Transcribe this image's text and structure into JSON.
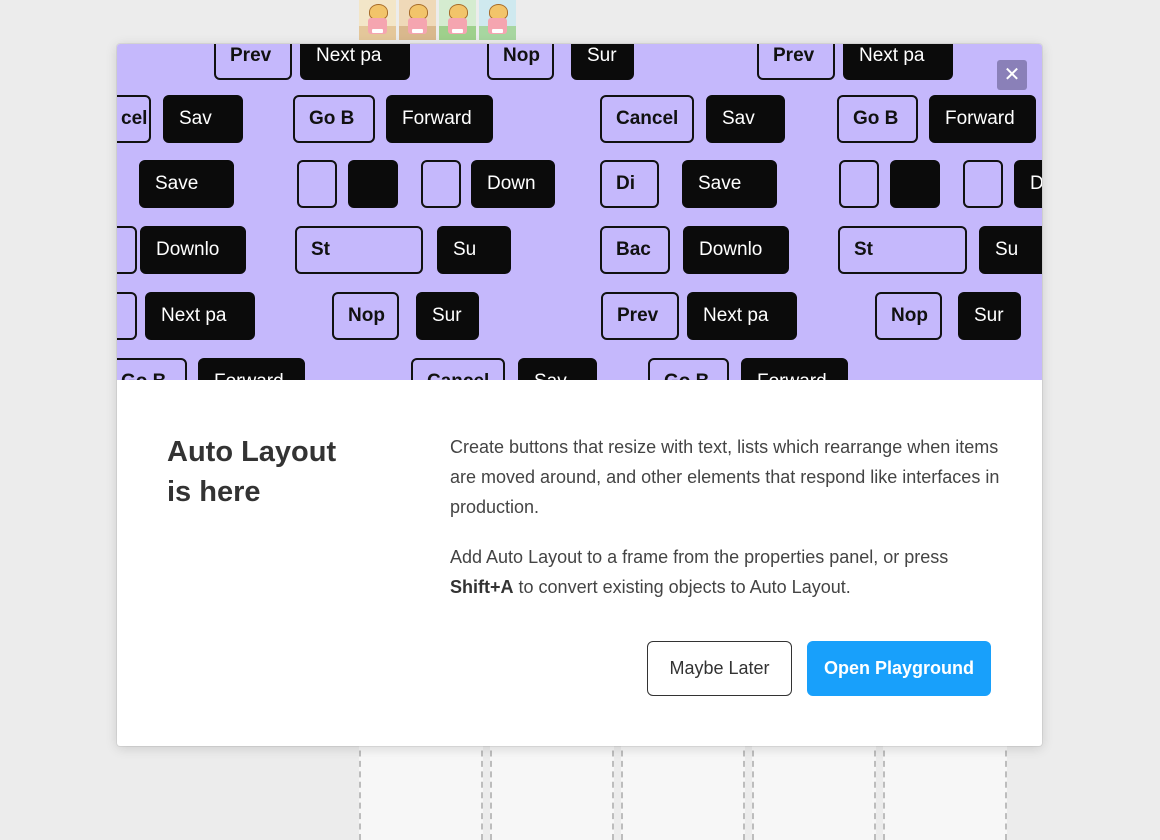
{
  "modal": {
    "title_line1": "Auto Layout",
    "title_line2": "is here",
    "paragraph1": "Create buttons that resize with text, lists which rearrange when items are moved around, and other elements that respond like interfaces in production.",
    "paragraph2_prefix": "Add Auto Layout to a frame from the properties panel, or press",
    "paragraph2_shortcut": "Shift+A",
    "paragraph2_suffix": "to convert existing objects to Auto Layout.",
    "close_label": "✕",
    "maybe_later_label": "Maybe Later",
    "open_playground_label": "Open Playground",
    "accent_color": "#18a0fb",
    "hero_color": "#c5b8fc"
  },
  "hero_buttons": [
    {
      "label": "Prev",
      "style": "light"
    },
    {
      "label": "Next pa",
      "style": "dark"
    },
    {
      "label": "Nop",
      "style": "light"
    },
    {
      "label": "Sur",
      "style": "dark"
    },
    {
      "label": "Prev",
      "style": "light"
    },
    {
      "label": "Next pa",
      "style": "dark"
    },
    {
      "label": "cel",
      "style": "light"
    },
    {
      "label": "Sav",
      "style": "dark"
    },
    {
      "label": "Go B",
      "style": "light"
    },
    {
      "label": "Forward",
      "style": "dark"
    },
    {
      "label": "Cancel",
      "style": "light"
    },
    {
      "label": "Sav",
      "style": "dark"
    },
    {
      "label": "Go B",
      "style": "light"
    },
    {
      "label": "Forward",
      "style": "dark"
    },
    {
      "label": "Save",
      "style": "dark"
    },
    {
      "label": "",
      "style": "light"
    },
    {
      "label": "",
      "style": "dark"
    },
    {
      "label": "",
      "style": "light"
    },
    {
      "label": "Down",
      "style": "dark"
    },
    {
      "label": "Di",
      "style": "light"
    },
    {
      "label": "Save",
      "style": "dark"
    },
    {
      "label": "",
      "style": "light"
    },
    {
      "label": "",
      "style": "dark"
    },
    {
      "label": "",
      "style": "light"
    },
    {
      "label": "D",
      "style": "dark"
    },
    {
      "label": "",
      "style": "light"
    },
    {
      "label": "Downlo",
      "style": "dark"
    },
    {
      "label": "St",
      "style": "light"
    },
    {
      "label": "Su",
      "style": "dark"
    },
    {
      "label": "Bac",
      "style": "light"
    },
    {
      "label": "Downlo",
      "style": "dark"
    },
    {
      "label": "St",
      "style": "light"
    },
    {
      "label": "Su",
      "style": "dark"
    },
    {
      "label": "",
      "style": "light"
    },
    {
      "label": "Next pa",
      "style": "dark"
    },
    {
      "label": "Nop",
      "style": "light"
    },
    {
      "label": "Sur",
      "style": "dark"
    },
    {
      "label": "Prev",
      "style": "light"
    },
    {
      "label": "Next pa",
      "style": "dark"
    },
    {
      "label": "Nop",
      "style": "light"
    },
    {
      "label": "Sur",
      "style": "dark"
    },
    {
      "label": "Go B",
      "style": "light"
    },
    {
      "label": "Forward",
      "style": "dark"
    },
    {
      "label": "Cancel",
      "style": "light"
    },
    {
      "label": "Sav",
      "style": "dark"
    },
    {
      "label": "Go B",
      "style": "light"
    },
    {
      "label": "Forward",
      "style": "dark"
    }
  ]
}
